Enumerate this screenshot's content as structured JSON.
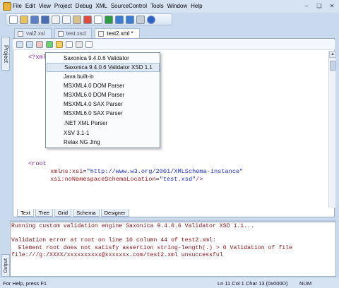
{
  "menubar": {
    "items": [
      "File",
      "Edit",
      "View",
      "Project",
      "Debug",
      "XML",
      "SourceControl",
      "Tools",
      "Window",
      "Help"
    ]
  },
  "sidebar": {
    "project_tab": "Project",
    "output_tab": "Output"
  },
  "doc_tabs": [
    {
      "label": "val2.xsl",
      "active": false
    },
    {
      "label": "test.xsd",
      "active": false
    },
    {
      "label": "test2.xml *",
      "active": true
    }
  ],
  "editor": {
    "line1": "<?xml",
    "root_open": "<root",
    "attr1_name": "xmlns:xsi",
    "attr1_value": "\"http://www.w3.org/2001/XMLSchema-instance\"",
    "attr2_name": "xsi:noNamespaceSchemaLocation",
    "attr2_value": "\"test.xsd\"",
    "close": "/>"
  },
  "validator_menu": {
    "items": [
      "Saxonica 9.4.0.6 Validator",
      "Saxonica 9.4.0.6 Validator XSD 1.1",
      "Java built-in",
      "MSXML4.0 DOM Parser",
      "MSXML6.0 DOM Parser",
      "MSXML4.0 SAX Parser",
      "MSXML6.0 SAX Parser",
      ".NET XML Parser",
      "XSV 3.1-1",
      "Relax NG Jing"
    ],
    "highlighted_index": 1
  },
  "view_tabs": [
    "Text",
    "Tree",
    "Grid",
    "Schema",
    "Designer"
  ],
  "output": {
    "line1": "Running custom validation engine Saxonica 9.4.0.6 Validator XSD 1.1...",
    "line2": "",
    "line3": "Validation error at root on line 10 column 44 of test2.xml:",
    "line4": "  Element root does not satisfy assertion string-length(.) > 0 Validation of file",
    "line5": "file:///g:/XXXX/xxxxxxxxxx@xxxxxxx.com/test2.xml unsuccessful"
  },
  "statusbar": {
    "help": "For Help, press F1",
    "position": "Ln 11 Col 1  Char 13 (0x000D)",
    "num": "NUM"
  },
  "colors": {
    "tag": "#7a1fa2",
    "attribute": "#a0161c",
    "value": "#1c2fd4",
    "output_error": "#8c1018"
  }
}
